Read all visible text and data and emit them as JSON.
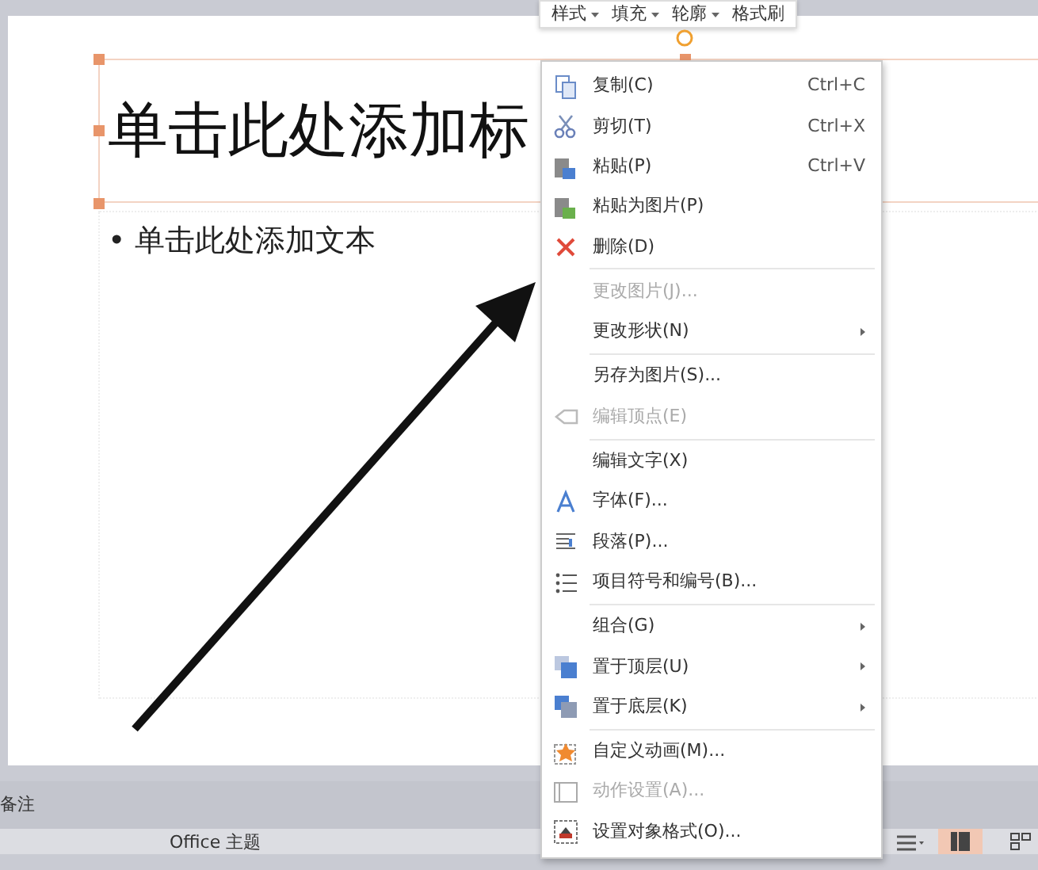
{
  "mini_toolbar": [
    {
      "label": "样式",
      "dropdown": true
    },
    {
      "label": "填充",
      "dropdown": true
    },
    {
      "label": "轮廓",
      "dropdown": true
    },
    {
      "label": "格式刷",
      "dropdown": false
    }
  ],
  "slide": {
    "title": "单击此处添加标",
    "body": "• 单击此处添加文本"
  },
  "context_menu": {
    "groups": [
      [
        {
          "label": "复制(C)",
          "shortcut": "Ctrl+C",
          "disabled": false,
          "submenu": false
        },
        {
          "label": "剪切(T)",
          "shortcut": "Ctrl+X",
          "disabled": false,
          "submenu": false
        },
        {
          "label": "粘贴(P)",
          "shortcut": "Ctrl+V",
          "disabled": false,
          "submenu": false
        },
        {
          "label": "粘贴为图片(P)",
          "disabled": false,
          "submenu": false
        },
        {
          "label": "删除(D)",
          "disabled": false,
          "submenu": false
        }
      ],
      [
        {
          "label": "更改图片(J)...",
          "disabled": true,
          "submenu": false
        },
        {
          "label": "更改形状(N)",
          "disabled": false,
          "submenu": true
        }
      ],
      [
        {
          "label": "另存为图片(S)...",
          "disabled": false,
          "submenu": false
        },
        {
          "label": "编辑顶点(E)",
          "disabled": true,
          "submenu": false
        }
      ],
      [
        {
          "label": "编辑文字(X)",
          "disabled": false,
          "submenu": false
        },
        {
          "label": "字体(F)...",
          "disabled": false,
          "submenu": false
        },
        {
          "label": "段落(P)...",
          "disabled": false,
          "submenu": false
        },
        {
          "label": "项目符号和编号(B)...",
          "disabled": false,
          "submenu": false
        }
      ],
      [
        {
          "label": "组合(G)",
          "disabled": false,
          "submenu": true
        },
        {
          "label": "置于顶层(U)",
          "disabled": false,
          "submenu": true
        },
        {
          "label": "置于底层(K)",
          "disabled": false,
          "submenu": true
        }
      ],
      [
        {
          "label": "自定义动画(M)...",
          "disabled": false,
          "submenu": false
        },
        {
          "label": "动作设置(A)...",
          "disabled": true,
          "submenu": false
        },
        {
          "label": "设置对象格式(O)...",
          "disabled": false,
          "submenu": false
        }
      ]
    ]
  },
  "notes_bar": {
    "label": "备注"
  },
  "status_bar": {
    "theme": "Office 主题"
  }
}
